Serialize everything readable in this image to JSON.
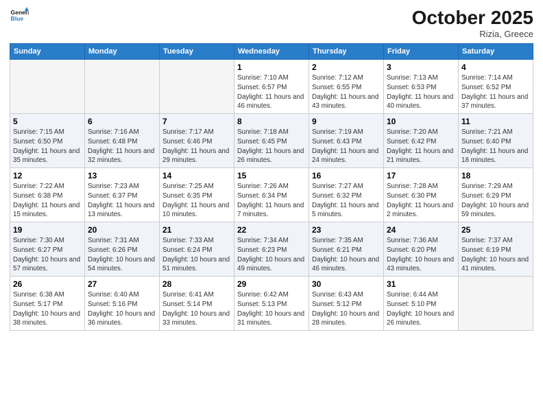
{
  "header": {
    "logo_line1": "General",
    "logo_line2": "Blue",
    "month": "October 2025",
    "location": "Rizia, Greece"
  },
  "weekdays": [
    "Sunday",
    "Monday",
    "Tuesday",
    "Wednesday",
    "Thursday",
    "Friday",
    "Saturday"
  ],
  "weeks": [
    [
      {
        "day": "",
        "info": ""
      },
      {
        "day": "",
        "info": ""
      },
      {
        "day": "",
        "info": ""
      },
      {
        "day": "1",
        "info": "Sunrise: 7:10 AM\nSunset: 6:57 PM\nDaylight: 11 hours and 46 minutes."
      },
      {
        "day": "2",
        "info": "Sunrise: 7:12 AM\nSunset: 6:55 PM\nDaylight: 11 hours and 43 minutes."
      },
      {
        "day": "3",
        "info": "Sunrise: 7:13 AM\nSunset: 6:53 PM\nDaylight: 11 hours and 40 minutes."
      },
      {
        "day": "4",
        "info": "Sunrise: 7:14 AM\nSunset: 6:52 PM\nDaylight: 11 hours and 37 minutes."
      }
    ],
    [
      {
        "day": "5",
        "info": "Sunrise: 7:15 AM\nSunset: 6:50 PM\nDaylight: 11 hours and 35 minutes."
      },
      {
        "day": "6",
        "info": "Sunrise: 7:16 AM\nSunset: 6:48 PM\nDaylight: 11 hours and 32 minutes."
      },
      {
        "day": "7",
        "info": "Sunrise: 7:17 AM\nSunset: 6:46 PM\nDaylight: 11 hours and 29 minutes."
      },
      {
        "day": "8",
        "info": "Sunrise: 7:18 AM\nSunset: 6:45 PM\nDaylight: 11 hours and 26 minutes."
      },
      {
        "day": "9",
        "info": "Sunrise: 7:19 AM\nSunset: 6:43 PM\nDaylight: 11 hours and 24 minutes."
      },
      {
        "day": "10",
        "info": "Sunrise: 7:20 AM\nSunset: 6:42 PM\nDaylight: 11 hours and 21 minutes."
      },
      {
        "day": "11",
        "info": "Sunrise: 7:21 AM\nSunset: 6:40 PM\nDaylight: 11 hours and 18 minutes."
      }
    ],
    [
      {
        "day": "12",
        "info": "Sunrise: 7:22 AM\nSunset: 6:38 PM\nDaylight: 11 hours and 15 minutes."
      },
      {
        "day": "13",
        "info": "Sunrise: 7:23 AM\nSunset: 6:37 PM\nDaylight: 11 hours and 13 minutes."
      },
      {
        "day": "14",
        "info": "Sunrise: 7:25 AM\nSunset: 6:35 PM\nDaylight: 11 hours and 10 minutes."
      },
      {
        "day": "15",
        "info": "Sunrise: 7:26 AM\nSunset: 6:34 PM\nDaylight: 11 hours and 7 minutes."
      },
      {
        "day": "16",
        "info": "Sunrise: 7:27 AM\nSunset: 6:32 PM\nDaylight: 11 hours and 5 minutes."
      },
      {
        "day": "17",
        "info": "Sunrise: 7:28 AM\nSunset: 6:30 PM\nDaylight: 11 hours and 2 minutes."
      },
      {
        "day": "18",
        "info": "Sunrise: 7:29 AM\nSunset: 6:29 PM\nDaylight: 10 hours and 59 minutes."
      }
    ],
    [
      {
        "day": "19",
        "info": "Sunrise: 7:30 AM\nSunset: 6:27 PM\nDaylight: 10 hours and 57 minutes."
      },
      {
        "day": "20",
        "info": "Sunrise: 7:31 AM\nSunset: 6:26 PM\nDaylight: 10 hours and 54 minutes."
      },
      {
        "day": "21",
        "info": "Sunrise: 7:33 AM\nSunset: 6:24 PM\nDaylight: 10 hours and 51 minutes."
      },
      {
        "day": "22",
        "info": "Sunrise: 7:34 AM\nSunset: 6:23 PM\nDaylight: 10 hours and 49 minutes."
      },
      {
        "day": "23",
        "info": "Sunrise: 7:35 AM\nSunset: 6:21 PM\nDaylight: 10 hours and 46 minutes."
      },
      {
        "day": "24",
        "info": "Sunrise: 7:36 AM\nSunset: 6:20 PM\nDaylight: 10 hours and 43 minutes."
      },
      {
        "day": "25",
        "info": "Sunrise: 7:37 AM\nSunset: 6:19 PM\nDaylight: 10 hours and 41 minutes."
      }
    ],
    [
      {
        "day": "26",
        "info": "Sunrise: 6:38 AM\nSunset: 5:17 PM\nDaylight: 10 hours and 38 minutes."
      },
      {
        "day": "27",
        "info": "Sunrise: 6:40 AM\nSunset: 5:16 PM\nDaylight: 10 hours and 36 minutes."
      },
      {
        "day": "28",
        "info": "Sunrise: 6:41 AM\nSunset: 5:14 PM\nDaylight: 10 hours and 33 minutes."
      },
      {
        "day": "29",
        "info": "Sunrise: 6:42 AM\nSunset: 5:13 PM\nDaylight: 10 hours and 31 minutes."
      },
      {
        "day": "30",
        "info": "Sunrise: 6:43 AM\nSunset: 5:12 PM\nDaylight: 10 hours and 28 minutes."
      },
      {
        "day": "31",
        "info": "Sunrise: 6:44 AM\nSunset: 5:10 PM\nDaylight: 10 hours and 26 minutes."
      },
      {
        "day": "",
        "info": ""
      }
    ]
  ]
}
